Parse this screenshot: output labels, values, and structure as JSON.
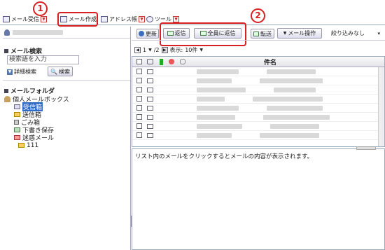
{
  "tabs": [
    {
      "label": "メール受信"
    },
    {
      "label": "メール作成"
    },
    {
      "label": "アドレス帳"
    },
    {
      "label": "ツール"
    }
  ],
  "callouts": [
    "1",
    "2"
  ],
  "user_account": "",
  "search": {
    "title": "メール検索",
    "placeholder": "検索語を入力",
    "advanced_label": "詳細検索",
    "search_button": "検索"
  },
  "folders": {
    "title": "メールフォルダ",
    "root": "個人メールボックス",
    "items": [
      {
        "label": "受信箱",
        "selected": true
      },
      {
        "label": "送信箱",
        "selected": false
      },
      {
        "label": "ごみ箱",
        "selected": false
      },
      {
        "label": "下書き保存",
        "selected": false
      },
      {
        "label": "迷惑メール",
        "selected": false
      },
      {
        "label": "111",
        "selected": false
      }
    ]
  },
  "toolbar": {
    "refresh": "更新",
    "reply": "返信",
    "reply_all": "全員に返信",
    "forward": "転送",
    "mail_action": "メール操作",
    "filter": "絞り込みなし"
  },
  "list": {
    "page_current": "1",
    "page_total": "/2",
    "display_label": "表示:",
    "display_count": "10件",
    "subject_header": "件名"
  },
  "preview": {
    "message": "リスト内のメールをクリックするとメールの内容が表示されます。"
  },
  "colors": {
    "callout": "#d82020",
    "selection": "#316ac5"
  }
}
